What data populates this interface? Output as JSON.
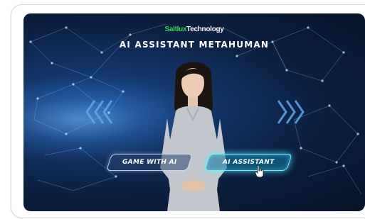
{
  "brand": {
    "part1": "Saltlux",
    "part2": "Technology"
  },
  "title": "AI ASSISTANT  METAHUMAN",
  "buttons": {
    "game": "GAME WITH AI",
    "assistant": "AI ASSISTANT"
  },
  "icons": {
    "left_arrows": "chevrons-left-icon",
    "right_arrows": "chevrons-right-icon",
    "cursor": "hand-pointer-icon"
  },
  "colors": {
    "brand_green": "#39d353",
    "accent_cyan": "#6ff0ff",
    "background_navy": "#0b1f40"
  }
}
